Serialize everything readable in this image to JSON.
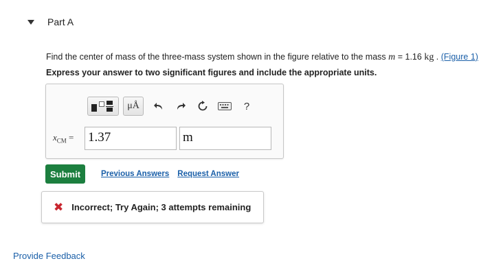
{
  "part": {
    "title": "Part A"
  },
  "question": {
    "text_prefix": "Find the center of mass of the three-mass system shown in the figure relative to the mass ",
    "mass_symbol": "m",
    "equals": " = 1.16 ",
    "mass_unit": "kg",
    "period": " . ",
    "figure_link": "(Figure 1)",
    "instruction": "Express your answer to two significant figures and include the appropriate units."
  },
  "toolbar": {
    "units_label": "μÅ",
    "help_label": "?"
  },
  "answer": {
    "variable": "x",
    "subscript": "CM",
    "equals": " =",
    "value": "1.37",
    "unit": "m"
  },
  "actions": {
    "submit": "Submit",
    "previous_answers": "Previous Answers",
    "request_answer": "Request Answer"
  },
  "feedback": {
    "icon": "✖",
    "message": "Incorrect; Try Again; 3 attempts remaining"
  },
  "footer": {
    "provide_feedback": "Provide Feedback"
  },
  "colors": {
    "submit_green": "#1c7f3f",
    "link_blue": "#1a5fa8",
    "error_red": "#c8262f"
  }
}
